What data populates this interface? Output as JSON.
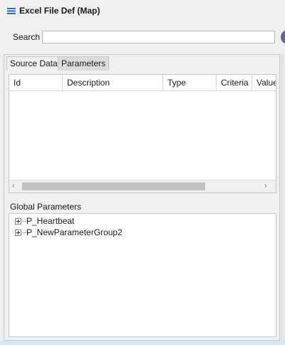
{
  "window": {
    "title": "Excel File Def (Map)",
    "icon": "list-icon"
  },
  "search": {
    "label": "Search",
    "value": "",
    "placeholder": ""
  },
  "tabs": [
    {
      "label": "Source Data",
      "selected": false
    },
    {
      "label": "Parameters",
      "selected": true
    }
  ],
  "table": {
    "columns": [
      "Id",
      "Description",
      "Type",
      "Criteria",
      "Value"
    ],
    "rows": []
  },
  "global_parameters": {
    "label": "Global Parameters",
    "items": [
      {
        "label": "P_Heartbeat",
        "expanded": false
      },
      {
        "label": "P_NewParameterGroup2",
        "expanded": false
      }
    ]
  },
  "colors": {
    "accent": "#2a6fb0",
    "selected_tab": "#dcdcdc"
  }
}
